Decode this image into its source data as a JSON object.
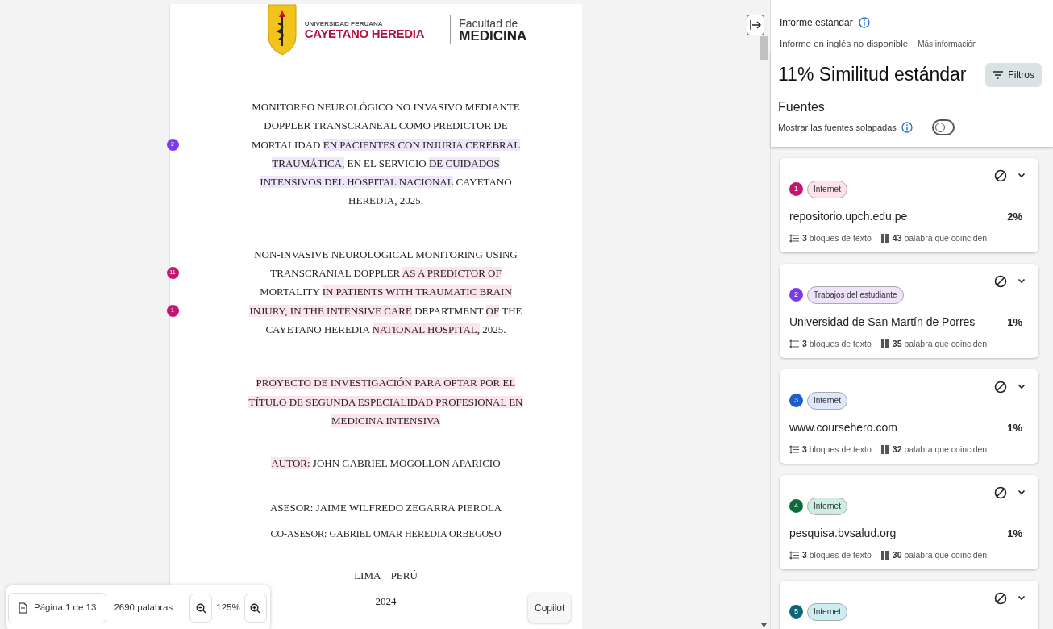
{
  "document": {
    "logo": {
      "university_small": "UNIVERSIDAD PERUANA",
      "university_large": "CAYETANO HEREDIA",
      "faculty_small": "Facultad de",
      "faculty_large": "MEDICINA"
    },
    "paragraphs": [
      {
        "kind": "title",
        "lines": [
          {
            "segments": [
              {
                "text": "MONITOREO NEUROLÓGICO NO INVASIVO MEDIANTE"
              }
            ]
          },
          {
            "segments": [
              {
                "text": "DOPPLER TRANSCRANEAL COMO PREDICTOR DE"
              }
            ]
          },
          {
            "marker": {
              "label": "2",
              "color": "#7c3aed"
            },
            "segments": [
              {
                "text": "MORTALIDAD "
              },
              {
                "text": "EN PACIENTES CON INJURIA CEREBRAL",
                "color": "#efe6fb"
              }
            ]
          },
          {
            "segments": [
              {
                "text": "TRAUMÁTICA,",
                "color": "#efe6fb"
              },
              {
                "text": " EN EL SERVICIO "
              },
              {
                "text": "DE CUIDADOS",
                "color": "#efe6fb"
              }
            ]
          },
          {
            "segments": [
              {
                "text": "INTENSIVOS DEL HOSPITAL NACIONAL",
                "color": "#efe6fb"
              },
              {
                "text": " CAYETANO"
              }
            ]
          },
          {
            "segments": [
              {
                "text": "HEREDIA, 2025."
              }
            ]
          }
        ]
      },
      {
        "kind": "title",
        "lines": [
          {
            "segments": [
              {
                "text": "NON-INVASIVE NEUROLOGICAL MONITORING USING"
              }
            ]
          },
          {
            "marker": {
              "label": "11",
              "color": "#c4166f"
            },
            "segments": [
              {
                "text": "TRANSCRANIAL DOPPLER "
              },
              {
                "text": "AS A PREDICTOR OF",
                "color": "#fbe4ee"
              }
            ]
          },
          {
            "segments": [
              {
                "text": "MORTALITY "
              },
              {
                "text": "IN PATIENTS WITH TRAUMATIC BRAIN",
                "color": "#fbe4ee"
              }
            ]
          },
          {
            "marker": {
              "label": "1",
              "color": "#c4166f"
            },
            "segments": [
              {
                "text": "INJURY, ",
                "color": "#fbe4ee"
              },
              {
                "text": "IN THE INTENSIVE CARE",
                "color": "#fbe4ee"
              },
              {
                "text": " DEPARTMENT "
              },
              {
                "text": "OF",
                "color": "#fbe4ee"
              },
              {
                "text": " THE"
              }
            ]
          },
          {
            "segments": [
              {
                "text": "CAYETANO HEREDIA "
              },
              {
                "text": "NATIONAL HOSPITAL,",
                "color": "#fbe4ee"
              },
              {
                "text": " 2025."
              }
            ]
          }
        ]
      },
      {
        "kind": "title",
        "lines": [
          {
            "segments": [
              {
                "text": "PROYECTO DE INVESTIGACIÓN PARA OPTAR POR EL",
                "color": "#fbe4ee"
              }
            ]
          },
          {
            "segments": [
              {
                "text": "TÍTULO DE SEGUNDA ESPECIALIDAD PROFESIONAL EN",
                "color": "#fbe4ee"
              }
            ]
          },
          {
            "segments": [
              {
                "text": "MEDICINA INTENSIVA",
                "color": "#fbe4ee"
              }
            ]
          }
        ]
      },
      {
        "kind": "line",
        "lines": [
          {
            "segments": [
              {
                "text": "AUTOR:",
                "color": "#fbe4ee"
              },
              {
                "text": " JOHN GABRIEL MOGOLLON APARICIO"
              }
            ]
          }
        ]
      },
      {
        "kind": "line",
        "lines": [
          {
            "segments": [
              {
                "text": "ASESOR: JAIME WILFREDO ZEGARRA PIEROLA"
              }
            ]
          }
        ]
      },
      {
        "kind": "small",
        "lines": [
          {
            "segments": [
              {
                "text": "CO-ASESOR: GABRIEL OMAR HEREDIA ORBEGOSO"
              }
            ]
          }
        ]
      },
      {
        "kind": "line",
        "lines": [
          {
            "segments": [
              {
                "text": "LIMA – PERÚ"
              }
            ]
          }
        ]
      },
      {
        "kind": "line",
        "lines": [
          {
            "segments": [
              {
                "text": "2024"
              }
            ]
          }
        ]
      }
    ]
  },
  "toolbar": {
    "page": "Página 1 de 13",
    "words": "2690 palabras",
    "zoom": "125%"
  },
  "copilot": "Copilot",
  "panel": {
    "report_title": "Informe estándar",
    "report_note": "Informe en inglés no disponible",
    "report_link": "Más información",
    "similarity": "11% Similitud estándar",
    "filters": "Filtros",
    "sources_title": "Fuentes",
    "overlap_label": "Mostrar las fuentes solapadas",
    "overlap_on": false,
    "sources": [
      {
        "number": "1",
        "color": "#c4166f",
        "tag": {
          "label": "Internet",
          "color": "#fde2ea"
        },
        "name": "repositorio.upch.edu.pe",
        "percent": "2%",
        "blocks": "3",
        "blocks_label": "bloques de texto",
        "words": "43",
        "words_label": "palabra que coinciden"
      },
      {
        "number": "2",
        "color": "#7c3aed",
        "tag": {
          "label": "Trabajos del estudiante",
          "color": "#ede4fb"
        },
        "name": "Universidad de San Martín de Porres",
        "percent": "1%",
        "blocks": "3",
        "blocks_label": "bloques de texto",
        "words": "35",
        "words_label": "palabra que coinciden"
      },
      {
        "number": "3",
        "color": "#1d5fc9",
        "tag": {
          "label": "Internet",
          "color": "#dce8fb"
        },
        "name": "www.coursehero.com",
        "percent": "1%",
        "blocks": "3",
        "blocks_label": "bloques de texto",
        "words": "32",
        "words_label": "palabra que coinciden"
      },
      {
        "number": "4",
        "color": "#0b6b3a",
        "tag": {
          "label": "Internet",
          "color": "#cdeee0"
        },
        "name": "pesquisa.bvsalud.org",
        "percent": "1%",
        "blocks": "3",
        "blocks_label": "bloques de texto",
        "words": "30",
        "words_label": "palabra que coinciden"
      },
      {
        "number": "5",
        "color": "#0b6577",
        "tag": {
          "label": "Internet",
          "color": "#cdeef0"
        }
      }
    ]
  }
}
